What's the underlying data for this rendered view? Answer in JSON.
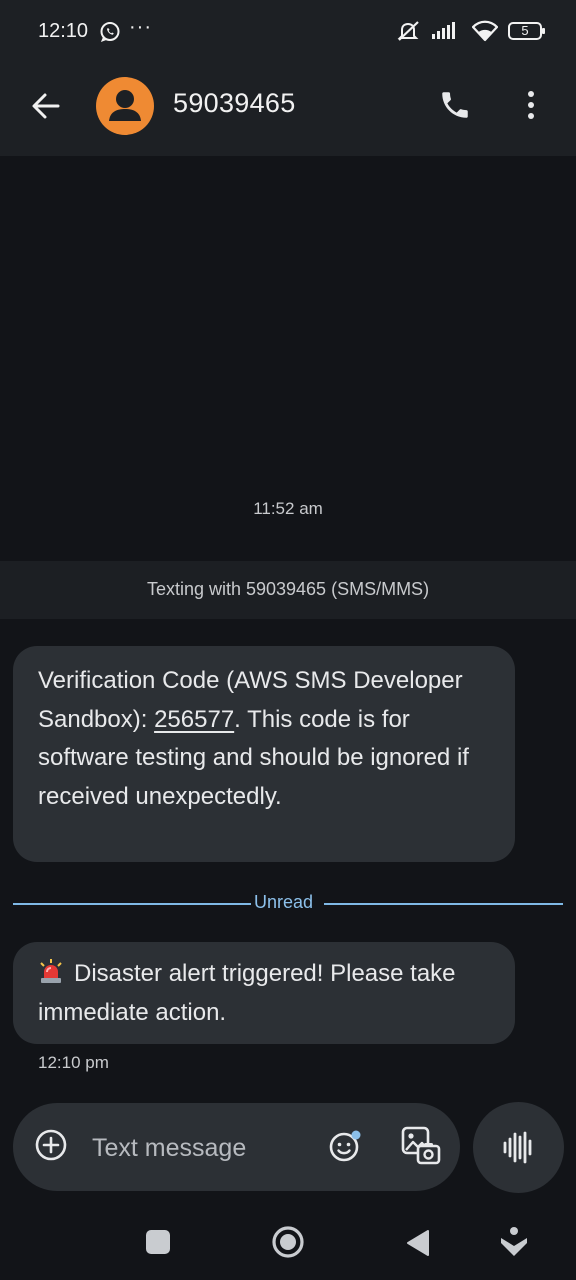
{
  "status_bar": {
    "time": "12:10",
    "overflow_indicator": "···",
    "battery_level": "5"
  },
  "app_bar": {
    "contact_name": "59039465",
    "icons": [
      "back-arrow-icon",
      "avatar-person-icon",
      "phone-icon",
      "more-vert-icon"
    ]
  },
  "conversation": {
    "timestamp_top": "11:52 am",
    "texting_with": "Texting with 59039465 (SMS/MMS)",
    "messages": [
      {
        "text_before": "Verification Code (AWS SMS Developer Sandbox): ",
        "code": "256577",
        "text_after": ". This code is for software testing and should be ignored if received unexpectedly."
      },
      {
        "emoji": "siren-icon",
        "text": "Disaster alert triggered! Please take immediate action.",
        "time": "12:10 pm"
      }
    ],
    "unread_label": "Unread"
  },
  "compose": {
    "placeholder": "Text message"
  },
  "colors": {
    "background": "#121418",
    "bubble": "#2c3035",
    "avatar": "#ef8a33",
    "unread": "#8cc0ea"
  }
}
